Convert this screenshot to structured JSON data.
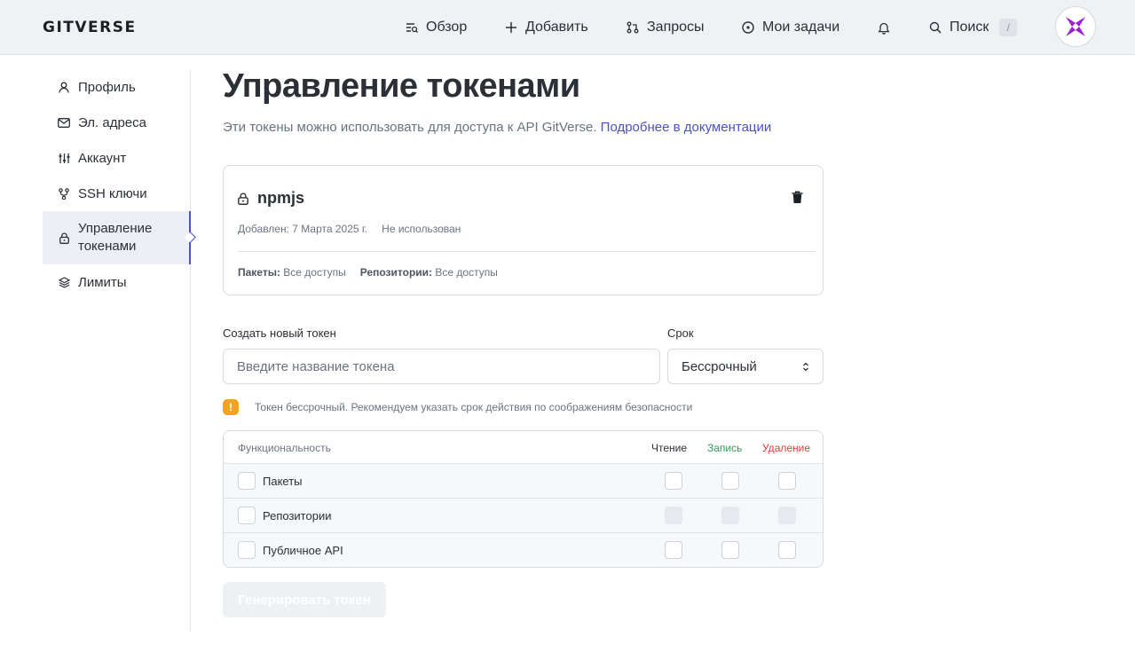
{
  "header": {
    "logo": "GITVERSE",
    "nav": [
      {
        "label": "Обзор",
        "icon": "overview-icon"
      },
      {
        "label": "Добавить",
        "icon": "plus-icon"
      },
      {
        "label": "Запросы",
        "icon": "pull-request-icon"
      },
      {
        "label": "Мои задачи",
        "icon": "circle-dot-icon"
      }
    ],
    "notifications_icon": "bell-icon",
    "search": {
      "label": "Поиск",
      "shortcut": "/"
    },
    "avatar_colors": {
      "primary": "#9b1fd1",
      "secondary": "#c25ae8"
    }
  },
  "sidebar": {
    "items": [
      {
        "label": "Профиль",
        "icon": "user-icon"
      },
      {
        "label": "Эл. адреса",
        "icon": "mail-icon"
      },
      {
        "label": "Аккаунт",
        "icon": "sliders-icon"
      },
      {
        "label": "SSH ключи",
        "icon": "key-branch-icon"
      },
      {
        "label": "Управление токенами",
        "icon": "lock-icon",
        "active": true
      },
      {
        "label": "Лимиты",
        "icon": "layers-icon"
      }
    ]
  },
  "main": {
    "title": "Управление токенами",
    "subtitle": "Эти токены можно использовать для доступа к API GitVerse.",
    "docs_link": "Подробнее в документации",
    "token": {
      "name": "npmjs",
      "added": "Добавлен: 7 Марта 2025 г.",
      "usage": "Не использован",
      "packages_label": "Пакеты:",
      "packages_value": "Все доступы",
      "repos_label": "Репозитории:",
      "repos_value": "Все доступы"
    },
    "create": {
      "label": "Создать новый токен",
      "placeholder": "Введите название токена",
      "value": ""
    },
    "expiry": {
      "label": "Срок",
      "selected": "Бессрочный"
    },
    "warning": "Токен бессрочный. Рекомендуем указать срок действия по соображениям безопасности",
    "permissions": {
      "header": {
        "feature": "Функциональность",
        "read": "Чтение",
        "write": "Запись",
        "delete": "Удаление"
      },
      "rows": [
        {
          "label": "Пакеты",
          "disabled": false
        },
        {
          "label": "Репозитории",
          "disabled": true
        },
        {
          "label": "Публичное API",
          "disabled": false
        }
      ],
      "colors": {
        "read": "#2b2f36",
        "write": "#2f9e5b",
        "delete": "#e23d32"
      }
    },
    "generate_button": "Генерировать токен"
  },
  "colors": {
    "accent": "#4a52c8",
    "warning": "#f2a321"
  }
}
